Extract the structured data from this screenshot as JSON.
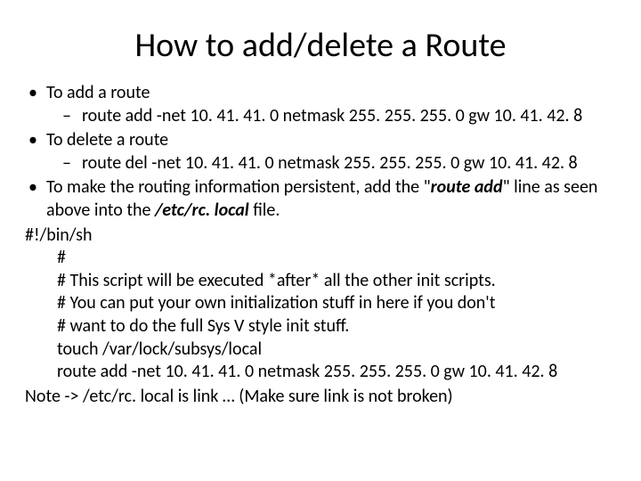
{
  "title": "How to add/delete a Route",
  "bullets": {
    "b1": "To add a route",
    "b1_sub": "route add -net 10. 41. 41. 0 netmask 255. 255. 255. 0 gw 10. 41. 42. 8",
    "b2": "To delete a route",
    "b2_sub": "route del -net 10. 41. 41. 0 netmask 255. 255. 255. 0 gw 10. 41. 42. 8",
    "b3_pre": "To make the routing information persistent, add the \"",
    "b3_em": "route add",
    "b3_mid": "\" line as seen above into the ",
    "b3_em2": "/etc/rc. local",
    "b3_post": " file."
  },
  "script": {
    "l0": "#!/bin/sh",
    "l1": "#",
    "l2": "# This script will be executed *after* all the other init scripts.",
    "l3": "# You can put your own initialization stuff in here if you don't",
    "l4": "# want to do the full Sys V style init stuff.",
    "l5": "touch /var/lock/subsys/local",
    "l6": "route add -net 10. 41. 41. 0 netmask 255. 255. 255. 0 gw 10. 41. 42. 8"
  },
  "note": "Note -> /etc/rc. local is link … (Make sure link is not broken)"
}
